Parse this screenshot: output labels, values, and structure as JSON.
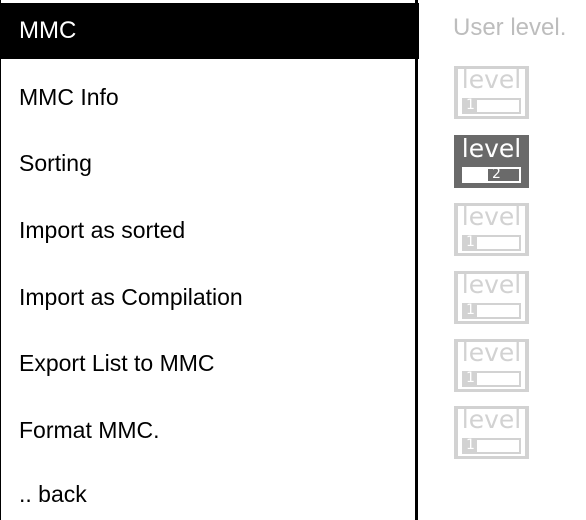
{
  "menu": {
    "title": "MMC",
    "items": [
      {
        "label": "MMC Info"
      },
      {
        "label": "Sorting"
      },
      {
        "label": "Import as sorted"
      },
      {
        "label": "Import as Compilation"
      },
      {
        "label": "Export List to MMC"
      },
      {
        "label": "Format MMC."
      },
      {
        "label": ".. back"
      }
    ]
  },
  "user_level": {
    "title": "User level.",
    "badges": [
      {
        "word": "level",
        "number": "1",
        "active": false
      },
      {
        "word": "level",
        "number": "2",
        "active": true
      },
      {
        "word": "level",
        "number": "1",
        "active": false
      },
      {
        "word": "level",
        "number": "1",
        "active": false
      },
      {
        "word": "level",
        "number": "1",
        "active": false
      },
      {
        "word": "level",
        "number": "1",
        "active": false
      }
    ]
  },
  "colors": {
    "header_bg": "#000000",
    "header_text": "#ffffff",
    "inactive_badge": "#d2d2d2",
    "active_badge": "#6a6a6a",
    "title_gray": "#bdbdbd"
  }
}
